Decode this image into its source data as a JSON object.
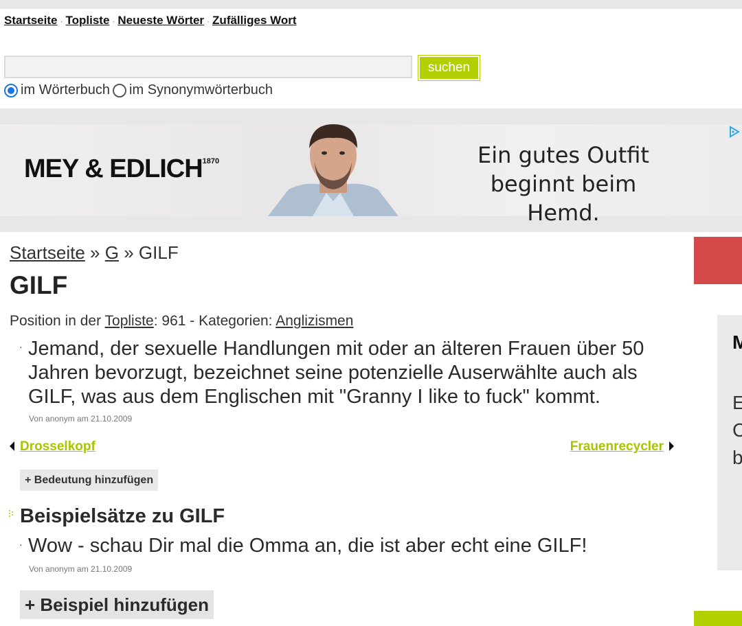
{
  "nav": {
    "items": [
      "Startseite",
      "Topliste",
      "Neueste Wörter",
      "Zufälliges Wort"
    ],
    "separator": "·"
  },
  "search": {
    "value": "",
    "placeholder": "",
    "button_label": "suchen",
    "options": [
      {
        "label": "im Wörterbuch",
        "checked": true
      },
      {
        "label": "im Synonymwörterbuch",
        "checked": false
      }
    ]
  },
  "ad": {
    "brand": "MEY & EDLICH",
    "brand_year": "1870",
    "slogan_line1": "Ein gutes Outfit",
    "slogan_line2": "beginnt beim Hemd."
  },
  "breadcrumb": {
    "home": "Startseite",
    "sep1": " » ",
    "letter": "G",
    "sep2": " » ",
    "current": "GILF"
  },
  "entry": {
    "title": "GILF",
    "meta_prefix": "Position in der ",
    "meta_link": "Topliste",
    "meta_middle": ": 961 - Kategorien: ",
    "category": "Anglizismen",
    "definition": "Jemand, der sexuelle Handlungen mit oder an älteren Frauen über 50 Jahren bevorzugt, bezeichnet seine potenzielle Auserwählte auch als GILF, was aus dem Englischen mit \"Granny I like to fuck\" kommt.",
    "definition_author": "Von anonym am 21.10.2009",
    "bullet": "·",
    "prev": "Drosselkopf",
    "next": "Frauenrecycler",
    "add_meaning": "+ Bedeutung hinzufügen"
  },
  "examples": {
    "heading": "Beispielsätze zu GILF",
    "items": [
      {
        "text": "Wow - schau Dir mal die Omma an, die ist aber echt eine GILF!",
        "author": "Von anonym am 21.10.2009"
      }
    ],
    "add_example": "+ Beispiel hinzufügen"
  },
  "sidebar": {
    "title_fragment": "M",
    "line1": "E",
    "line2": "C",
    "line3": "b"
  },
  "colors": {
    "accent": "#b4cf00",
    "link_green": "#a8c400",
    "side_red": "#d44a4a",
    "band_gray": "#e6e7e6"
  }
}
